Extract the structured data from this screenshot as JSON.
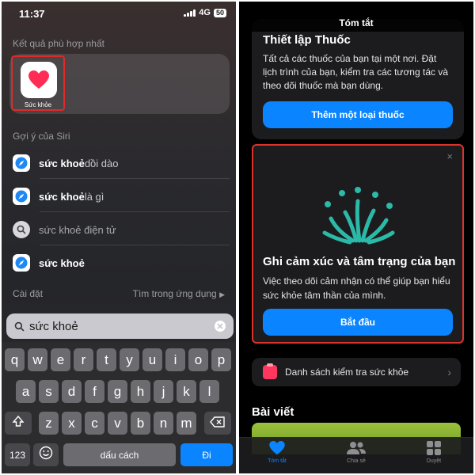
{
  "left": {
    "status": {
      "time": "11:37",
      "network": "4G",
      "battery": "50"
    },
    "best_match_label": "Kết quả phù hợp nhất",
    "app": {
      "name": "Sức khỏe",
      "icon": "heart-icon"
    },
    "siri_label": "Gợi ý của Siri",
    "siri_items": [
      {
        "bold": "sức khoẻ",
        "rest": " dồi dào",
        "icon": "safari-icon"
      },
      {
        "bold": "sức khoẻ",
        "rest": " là gì",
        "icon": "safari-icon"
      },
      {
        "bold": "",
        "rest": "sức khoẻ điện tử",
        "icon": "search-icon"
      },
      {
        "bold": "sức khoẻ",
        "rest": "",
        "icon": "safari-icon"
      }
    ],
    "settings_label": "Cài đặt",
    "search_in_app": "Tìm trong ứng dụng",
    "search_value": "sức khoẻ",
    "keyboard": {
      "row1": [
        "q",
        "w",
        "e",
        "r",
        "t",
        "y",
        "u",
        "i",
        "o",
        "p"
      ],
      "row2": [
        "a",
        "s",
        "d",
        "f",
        "g",
        "h",
        "j",
        "k",
        "l"
      ],
      "row3": [
        "z",
        "x",
        "c",
        "v",
        "b",
        "n",
        "m"
      ],
      "numbers_key": "123",
      "space_key": "dấu cách",
      "go_key": "Đi"
    }
  },
  "right": {
    "title": "Tóm tắt",
    "meds_card": {
      "heading": "Thiết lập Thuốc",
      "body": "Tất cả các thuốc của bạn tại một nơi. Đặt lịch trình của bạn, kiểm tra các tương tác và theo dõi thuốc mà bạn dùng.",
      "button": "Thêm một loại thuốc"
    },
    "mood_card": {
      "close": "×",
      "heading": "Ghi cảm xúc và tâm trạng của bạn",
      "body": "Việc theo dõi cảm nhận có thể giúp bạn hiểu sức khỏe tâm thần của mình.",
      "button": "Bắt đầu"
    },
    "checklist": "Danh sách kiểm tra sức khỏe",
    "articles": "Bài viết",
    "tabs": [
      {
        "label": "Tóm tắt",
        "icon": "heart-icon",
        "active": true
      },
      {
        "label": "Chia sẻ",
        "icon": "people-icon",
        "active": false
      },
      {
        "label": "Duyệt",
        "icon": "grid-icon",
        "active": false
      }
    ],
    "colors": {
      "accent": "#0a84ff",
      "highlight_border": "#d9332a",
      "health_pink": "#ff375f",
      "mood_teal": "#2bb9a8"
    }
  }
}
